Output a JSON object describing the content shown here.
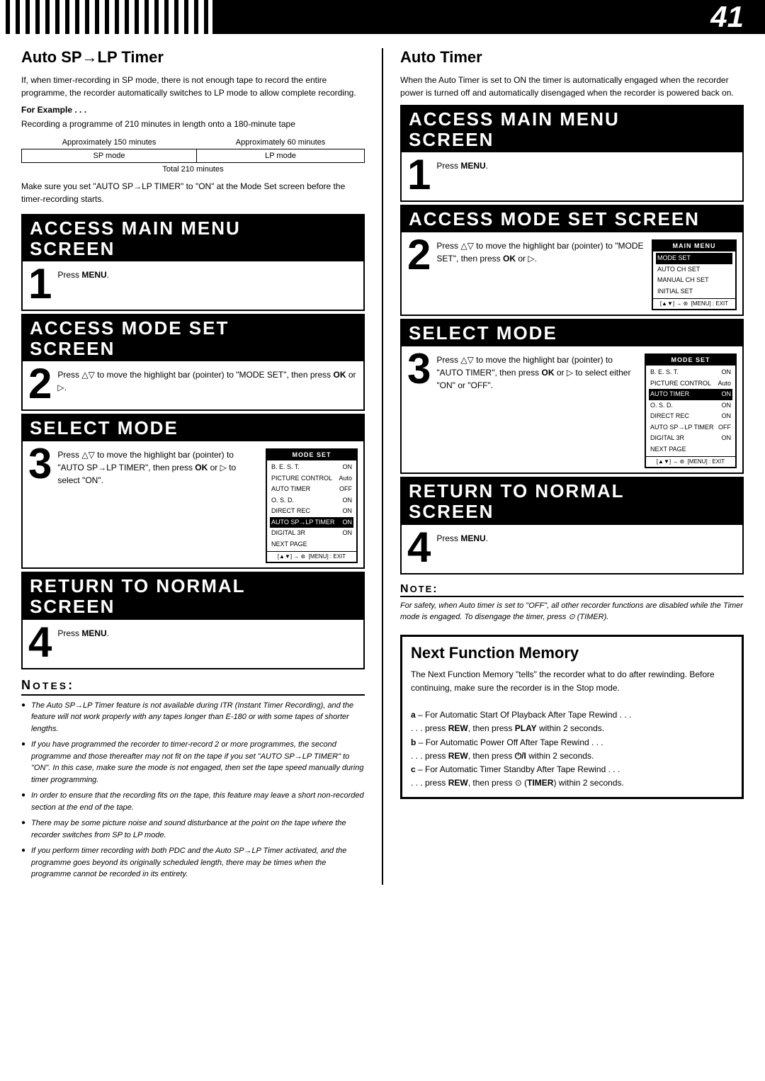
{
  "page": {
    "number": "41",
    "header_stripes": true
  },
  "left_section": {
    "title": "Auto SP→LP Timer",
    "description": "If, when timer-recording in SP mode, there is not enough tape to record the entire programme, the recorder automatically switches to LP mode to allow complete recording.",
    "for_example_label": "For Example . . .",
    "example_text": "Recording a programme of 210 minutes in length onto a 180-minute tape",
    "table": {
      "col1_header": "Approximately 150 minutes",
      "col2_header": "Approximately 60 minutes",
      "col1_mode": "SP mode",
      "col2_mode": "LP mode",
      "total_label": "Total 210 minutes"
    },
    "make_sure_text": "Make sure you set \"AUTO SP→LP TIMER\" to \"ON\" at the Mode Set screen before the timer-recording starts.",
    "steps": [
      {
        "number": "1",
        "header": "ACCESS MAIN MENU SCREEN",
        "body": "Press MENU.",
        "has_screen": false
      },
      {
        "number": "2",
        "header": "ACCESS MODE SET SCREEN",
        "body": "Press △▽ to move the highlight bar (pointer) to \"MODE SET\", then press OK or ▷.",
        "has_screen": false
      },
      {
        "number": "3",
        "header": "SELECT MODE",
        "body": "Press △▽ to move the highlight bar (pointer) to \"AUTO SP→LP TIMER\", then press OK or ▷ to select \"ON\".",
        "has_screen": true,
        "screen": {
          "title": "MODE SET",
          "items": [
            {
              "label": "B. E. S. T.",
              "value": "ON",
              "highlighted": false
            },
            {
              "label": "PICTURE CONTROL",
              "value": "Auto",
              "highlighted": false
            },
            {
              "label": "AUTO TIMER",
              "value": "OFF",
              "highlighted": false
            },
            {
              "label": "O. S. D.",
              "value": "ON",
              "highlighted": false
            },
            {
              "label": "DIRECT REC",
              "value": "ON",
              "highlighted": false
            },
            {
              "label": "AUTO SP→LP TIMER",
              "value": "ON",
              "highlighted": true
            },
            {
              "label": "DIGITAL 3R",
              "value": "ON",
              "highlighted": false
            },
            {
              "label": "NEXT PAGE",
              "value": "",
              "highlighted": false
            }
          ],
          "footer": "[▲▼] → ⊛  [MENU] : EXIT"
        }
      },
      {
        "number": "4",
        "header": "RETURN TO NORMAL SCREEN",
        "body": "Press MENU.",
        "has_screen": false
      }
    ],
    "notes": {
      "title": "NOTES:",
      "items": [
        "The Auto SP→LP Timer feature is not available during ITR (Instant Timer Recording), and the feature will not work properly with any tapes longer than E-180 or with some tapes of shorter lengths.",
        "If you have programmed the recorder to timer-record 2 or more programmes, the second programme and those thereafter may not fit on the tape if you set \"AUTO SP→LP TIMER\" to \"ON\". In this case, make sure the mode is not engaged, then set the tape speed manually during timer programming.",
        "In order to ensure that the recording fits on the tape, this feature may leave a short non-recorded section at the end of the tape.",
        "There may be some picture noise and sound disturbance at the point on the tape where the recorder switches from SP to LP mode.",
        "If you perform timer recording with both PDC and the Auto SP→LP Timer activated, and the programme goes beyond its originally scheduled length, there may be times when the programme cannot be recorded in its entirety."
      ]
    }
  },
  "right_section": {
    "title": "Auto Timer",
    "description": "When the Auto Timer is set to ON the timer is automatically engaged when the recorder power is turned off and automatically disengaged when the recorder is powered back on.",
    "steps": [
      {
        "number": "1",
        "header": "ACCESS MAIN MENU SCREEN",
        "body": "Press MENU.",
        "has_screen": false
      },
      {
        "number": "2",
        "header": "ACCESS MODE SET SCREEN",
        "body": "Press △▽ to move the highlight bar (pointer) to \"MODE SET\", then press OK or ▷.",
        "has_screen": true,
        "screen": {
          "title": "MAIN MENU",
          "items": [
            {
              "label": "MODE SET",
              "value": "",
              "highlighted": true
            },
            {
              "label": "AUTO CH SET",
              "value": "",
              "highlighted": false
            },
            {
              "label": "MANUAL CH SET",
              "value": "",
              "highlighted": false
            },
            {
              "label": "INITIAL SET",
              "value": "",
              "highlighted": false
            }
          ],
          "footer": "[▲▼] → ⊛  [MENU] : EXIT"
        }
      },
      {
        "number": "3",
        "header": "SELECT MODE",
        "body": "Press △▽ to move the highlight bar (pointer) to \"AUTO TIMER\", then press OK or ▷ to select either \"ON\" or \"OFF\".",
        "has_screen": true,
        "screen": {
          "title": "MODE SET",
          "items": [
            {
              "label": "B. E. S. T.",
              "value": "ON",
              "highlighted": false
            },
            {
              "label": "PICTURE CONTROL",
              "value": "Auto",
              "highlighted": false
            },
            {
              "label": "AUTO TIMER",
              "value": "ON",
              "highlighted": true
            },
            {
              "label": "O. S. D.",
              "value": "ON",
              "highlighted": false
            },
            {
              "label": "DIRECT REC",
              "value": "ON",
              "highlighted": false
            },
            {
              "label": "AUTO SP→LP TIMER",
              "value": "OFF",
              "highlighted": false
            },
            {
              "label": "DIGITAL 3R",
              "value": "ON",
              "highlighted": false
            },
            {
              "label": "NEXT PAGE",
              "value": "",
              "highlighted": false
            }
          ],
          "footer": "[▲▼] → ⊛  [MENU] : EXIT"
        }
      },
      {
        "number": "4",
        "header": "RETURN TO NORMAL SCREEN",
        "body": "Press MENU.",
        "has_screen": false
      }
    ],
    "note": {
      "title": "NOTE:",
      "text": "For safety, when Auto timer is set to \"OFF\", all other recorder functions are disabled while the Timer mode is engaged. To disengage the timer, press ⊙ (TIMER)."
    },
    "next_function_memory": {
      "title": "Next Function Memory",
      "description": "The Next Function Memory \"tells\" the recorder what to do after rewinding. Before continuing, make sure the recorder is in the Stop mode.",
      "items": [
        {
          "label": "a",
          "text": "– For Automatic Start Of Playback After Tape Rewind . . .",
          "sub": ". . . press REW, then press PLAY within 2 seconds."
        },
        {
          "label": "b",
          "text": "– For Automatic Power Off After Tape Rewind . . .",
          "sub": ". . . press REW, then press ⏻/I within 2 seconds."
        },
        {
          "label": "c",
          "text": "– For Automatic Timer Standby After Tape Rewind . . .",
          "sub": ". . . press REW, then press ⊙ (TIMER) within 2 seconds."
        }
      ]
    }
  }
}
